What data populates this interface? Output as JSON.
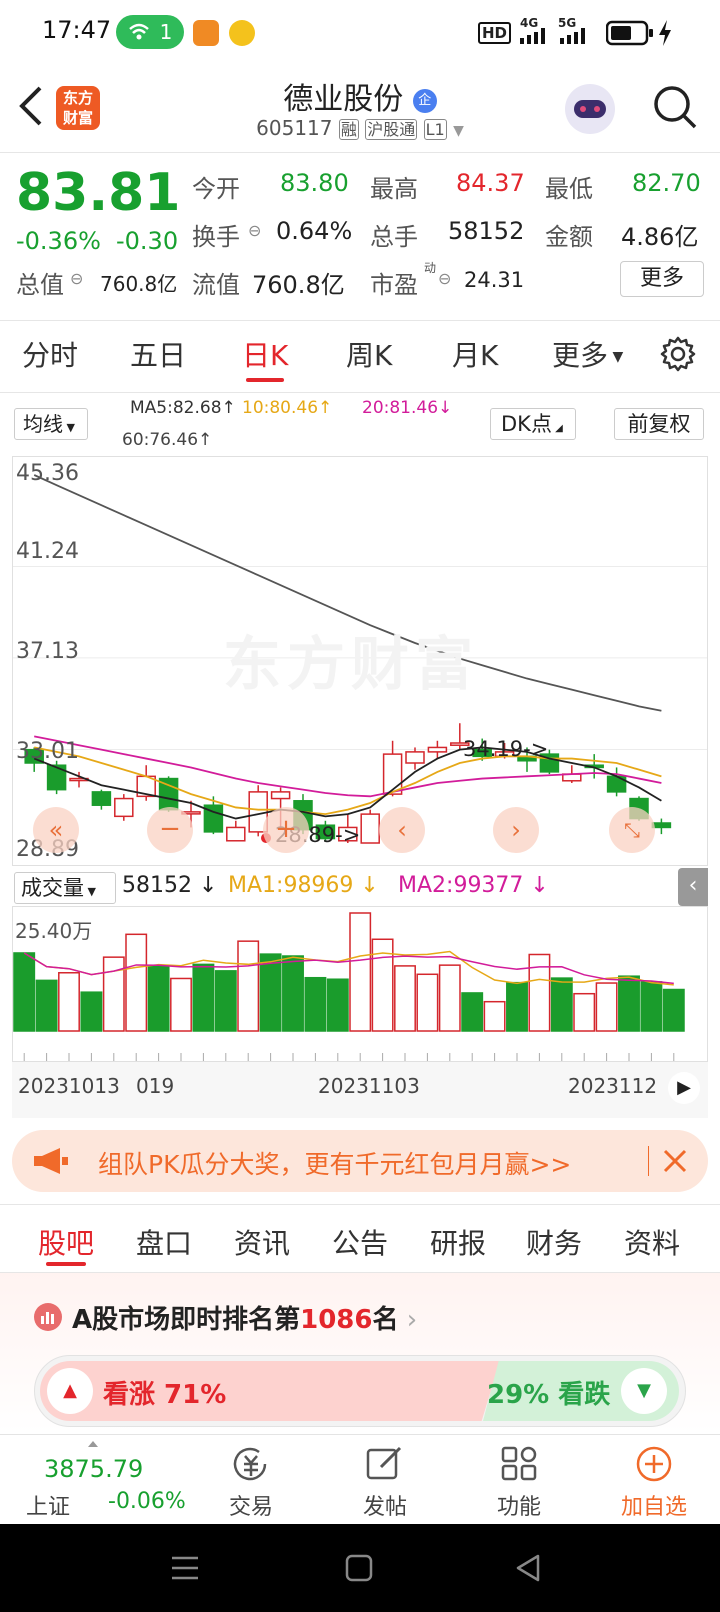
{
  "status": {
    "time": "17:47",
    "wifi_count": "1",
    "network": "HD",
    "sig1": "4G",
    "sig2": "5G"
  },
  "header": {
    "title": "德业股份",
    "badge": "企",
    "code": "605117",
    "tags": [
      "融",
      "沪股通",
      "L1"
    ],
    "logo_line1": "东方",
    "logo_line2": "财富"
  },
  "quote": {
    "price": "83.81",
    "change_pct": "-0.36%",
    "change": "-0.30",
    "open_label": "今开",
    "open": "83.80",
    "high_label": "最高",
    "high": "84.37",
    "low_label": "最低",
    "low": "82.70",
    "turnover_label": "换手",
    "turnover": "0.64%",
    "volume_label": "总手",
    "volume": "58152",
    "amount_label": "金额",
    "amount": "4.86亿",
    "mcap_label": "总值",
    "mcap": "760.8亿",
    "float_label": "流值",
    "float": "760.8亿",
    "pe_label": "市盈",
    "pe_sup": "动",
    "pe": "24.31",
    "more": "更多"
  },
  "tabs": [
    "分时",
    "五日",
    "日K",
    "周K",
    "月K",
    "更多"
  ],
  "kline": {
    "ma_selector": "均线",
    "ma5": "MA5:82.68",
    "ma10": "10:80.46",
    "ma20": "20:81.46",
    "ma60": "60:76.46",
    "dk": "DK点",
    "fq": "前复权",
    "y_labels": [
      "45.36",
      "41.24",
      "37.13",
      "33.01",
      "28.89"
    ],
    "high_mark": "34.19->",
    "low_mark": "28.89->",
    "watermark": "东方财富"
  },
  "volume": {
    "selector": "成交量",
    "vol": "58152",
    "ma1": "MA1:98969",
    "ma2": "MA2:99377",
    "max_label": "25.40万",
    "dates": [
      "20231013",
      "019",
      "20231103",
      "2023112"
    ]
  },
  "chart_data": {
    "type": "candlestick",
    "ylim": [
      28.89,
      45.36
    ],
    "candles": [
      {
        "o": 33.0,
        "c": 32.4,
        "h": 33.1,
        "l": 32.0
      },
      {
        "o": 32.3,
        "c": 31.2,
        "h": 32.5,
        "l": 31.0
      },
      {
        "o": 31.7,
        "c": 31.7,
        "h": 32.0,
        "l": 31.3
      },
      {
        "o": 31.1,
        "c": 30.5,
        "h": 31.2,
        "l": 30.3
      },
      {
        "o": 30.0,
        "c": 30.8,
        "h": 31.0,
        "l": 29.8
      },
      {
        "o": 30.9,
        "c": 31.8,
        "h": 32.3,
        "l": 30.7
      },
      {
        "o": 31.7,
        "c": 30.3,
        "h": 31.8,
        "l": 30.2
      },
      {
        "o": 30.2,
        "c": 30.2,
        "h": 30.7,
        "l": 29.5
      },
      {
        "o": 30.5,
        "c": 29.3,
        "h": 30.9,
        "l": 29.2
      },
      {
        "o": 28.9,
        "c": 29.5,
        "h": 29.8,
        "l": 28.9
      },
      {
        "o": 29.3,
        "c": 31.1,
        "h": 31.4,
        "l": 29.1
      },
      {
        "o": 30.8,
        "c": 31.1,
        "h": 31.3,
        "l": 29.4
      },
      {
        "o": 30.7,
        "c": 29.4,
        "h": 31.0,
        "l": 29.2
      },
      {
        "o": 29.6,
        "c": 29.0,
        "h": 29.8,
        "l": 28.9
      },
      {
        "o": 28.9,
        "c": 29.5,
        "h": 30.1,
        "l": 28.8
      },
      {
        "o": 28.8,
        "c": 30.1,
        "h": 30.3,
        "l": 28.8
      },
      {
        "o": 31.0,
        "c": 32.8,
        "h": 33.4,
        "l": 30.9
      },
      {
        "o": 32.4,
        "c": 32.9,
        "h": 33.1,
        "l": 32.1
      },
      {
        "o": 32.9,
        "c": 33.1,
        "h": 33.4,
        "l": 32.6
      },
      {
        "o": 33.2,
        "c": 33.3,
        "h": 34.19,
        "l": 33.0
      },
      {
        "o": 33.0,
        "c": 32.7,
        "h": 33.5,
        "l": 32.5
      },
      {
        "o": 32.7,
        "c": 32.9,
        "h": 33.3,
        "l": 32.6
      },
      {
        "o": 32.7,
        "c": 32.5,
        "h": 33.1,
        "l": 32.0
      },
      {
        "o": 32.8,
        "c": 32.0,
        "h": 33.0,
        "l": 31.9
      },
      {
        "o": 31.6,
        "c": 31.9,
        "h": 32.3,
        "l": 31.5
      },
      {
        "o": 32.3,
        "c": 32.2,
        "h": 32.8,
        "l": 31.7
      },
      {
        "o": 31.8,
        "c": 31.1,
        "h": 32.2,
        "l": 30.9
      },
      {
        "o": 30.8,
        "c": 29.9,
        "h": 30.9,
        "l": 29.8
      },
      {
        "o": 29.7,
        "c": 29.5,
        "h": 29.9,
        "l": 29.2
      }
    ],
    "ma60": [
      45.36,
      44.9,
      44.45,
      44.0,
      43.55,
      43.1,
      42.65,
      42.2,
      41.75,
      41.3,
      40.85,
      40.4,
      39.95,
      39.5,
      39.05,
      38.6,
      38.2,
      37.8,
      37.45,
      37.1,
      36.8,
      36.5,
      36.2,
      35.95,
      35.7,
      35.45,
      35.2,
      34.95,
      34.75
    ],
    "ma20": [
      33.6,
      33.4,
      33.2,
      33.0,
      32.8,
      32.6,
      32.4,
      32.2,
      31.95,
      31.7,
      31.5,
      31.35,
      31.2,
      31.05,
      30.95,
      30.9,
      31.1,
      31.3,
      31.5,
      31.6,
      31.7,
      31.75,
      31.8,
      31.85,
      31.9,
      31.95,
      31.9,
      31.7,
      31.5
    ],
    "ma10": [
      33.1,
      32.9,
      32.7,
      32.4,
      32.1,
      31.8,
      31.4,
      31.0,
      30.7,
      30.4,
      30.3,
      30.3,
      30.2,
      30.1,
      30.3,
      30.6,
      31.1,
      31.5,
      32.0,
      32.4,
      32.6,
      32.7,
      32.7,
      32.6,
      32.6,
      32.5,
      32.4,
      32.1,
      31.8
    ],
    "ma5": [
      32.6,
      32.2,
      31.8,
      31.4,
      31.2,
      31.0,
      30.8,
      30.6,
      30.2,
      29.9,
      30.1,
      30.3,
      30.2,
      30.0,
      30.1,
      30.4,
      31.2,
      32.0,
      32.6,
      33.0,
      33.1,
      33.0,
      32.9,
      32.6,
      32.4,
      32.2,
      31.8,
      31.3,
      30.7
    ],
    "volumes": [
      {
        "v": 20.5,
        "up": false
      },
      {
        "v": 13.3,
        "up": false
      },
      {
        "v": 15.3,
        "up": true
      },
      {
        "v": 10.2,
        "up": false
      },
      {
        "v": 19.4,
        "up": true
      },
      {
        "v": 25.4,
        "up": true
      },
      {
        "v": 16.9,
        "up": false
      },
      {
        "v": 13.8,
        "up": true
      },
      {
        "v": 17.5,
        "up": false
      },
      {
        "v": 15.8,
        "up": false
      },
      {
        "v": 23.6,
        "up": true
      },
      {
        "v": 20.2,
        "up": false
      },
      {
        "v": 19.7,
        "up": false
      },
      {
        "v": 14.0,
        "up": false
      },
      {
        "v": 13.6,
        "up": false
      },
      {
        "v": 31.0,
        "up": true
      },
      {
        "v": 24.1,
        "up": true
      },
      {
        "v": 17.1,
        "up": true
      },
      {
        "v": 14.9,
        "up": true
      },
      {
        "v": 17.3,
        "up": true
      },
      {
        "v": 10.0,
        "up": false
      },
      {
        "v": 7.7,
        "up": true
      },
      {
        "v": 12.7,
        "up": false
      },
      {
        "v": 20.1,
        "up": true
      },
      {
        "v": 13.9,
        "up": false
      },
      {
        "v": 9.8,
        "up": true
      },
      {
        "v": 12.6,
        "up": true
      },
      {
        "v": 14.4,
        "up": false
      },
      {
        "v": 12.9,
        "up": false
      },
      {
        "v": 10.9,
        "up": false
      }
    ]
  },
  "promo": {
    "text": "组队PK瓜分大奖，更有千元红包月月赢>>"
  },
  "bottom_tabs": [
    "股吧",
    "盘口",
    "资讯",
    "公告",
    "研报",
    "财务",
    "资料"
  ],
  "rank": {
    "prefix": "A股市场即时排名第",
    "num": "1086",
    "suffix": "名"
  },
  "sentiment": {
    "bull": "看涨 71%",
    "bear": "29% 看跌",
    "bull_pct": 71
  },
  "bottom_nav": {
    "index_value": "3875.79",
    "index_name": "上证",
    "index_change": "-0.06%",
    "trade": "交易",
    "post": "发帖",
    "func": "功能",
    "watch": "加自选"
  }
}
